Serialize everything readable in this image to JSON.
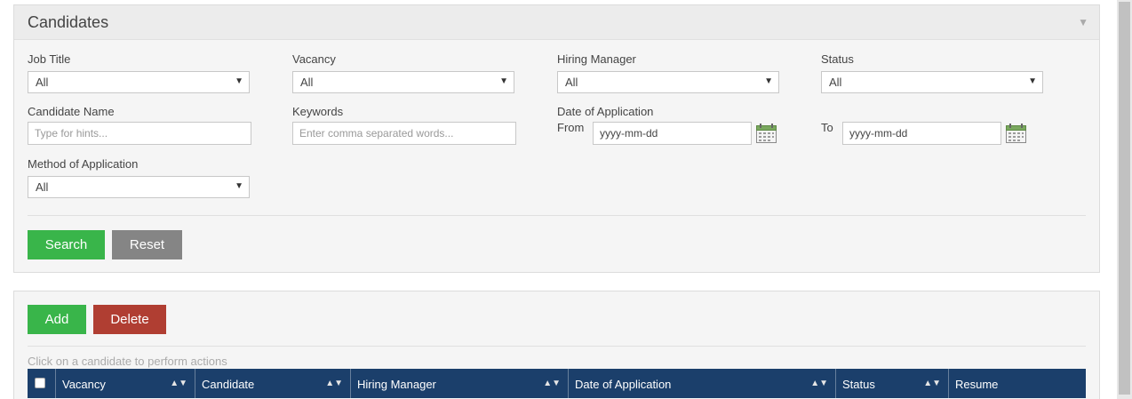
{
  "search_panel": {
    "title": "Candidates",
    "fields": {
      "job_title": {
        "label": "Job Title",
        "value": "All"
      },
      "vacancy": {
        "label": "Vacancy",
        "value": "All"
      },
      "hiring_manager": {
        "label": "Hiring Manager",
        "value": "All"
      },
      "status": {
        "label": "Status",
        "value": "All"
      },
      "candidate_name": {
        "label": "Candidate Name",
        "placeholder": "Type for hints..."
      },
      "keywords": {
        "label": "Keywords",
        "placeholder": "Enter comma separated words..."
      },
      "date_of_application": {
        "label": "Date of Application",
        "from_label": "From",
        "from_placeholder": "yyyy-mm-dd",
        "to_label": "To",
        "to_placeholder": "yyyy-mm-dd"
      },
      "method_of_application": {
        "label": "Method of Application",
        "value": "All"
      }
    },
    "buttons": {
      "search": "Search",
      "reset": "Reset"
    }
  },
  "list_panel": {
    "buttons": {
      "add": "Add",
      "delete": "Delete"
    },
    "hint": "Click on a candidate to perform actions",
    "columns": [
      "Vacancy",
      "Candidate",
      "Hiring Manager",
      "Date of Application",
      "Status",
      "Resume"
    ]
  },
  "icons": {
    "collapse": "triangle-down-icon",
    "calendar": "calendar-icon",
    "sort": "sort-up-down-icon"
  },
  "colors": {
    "primary_green": "#39b54a",
    "reset_grey": "#858585",
    "delete_red": "#b03e32",
    "table_header": "#1b3f6b"
  }
}
